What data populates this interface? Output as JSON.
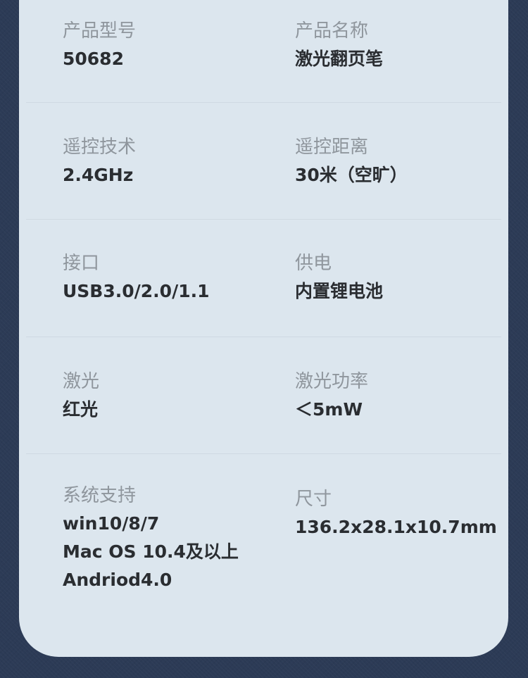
{
  "specs": [
    {
      "label": "产品型号",
      "value": [
        "50682"
      ]
    },
    {
      "label": "产品名称",
      "value": [
        "激光翻页笔"
      ]
    },
    {
      "label": "遥控技术",
      "value": [
        "2.4GHz"
      ]
    },
    {
      "label": "遥控距离",
      "value": [
        "30米（空旷）"
      ]
    },
    {
      "label": "接口",
      "value": [
        "USB3.0/2.0/1.1"
      ]
    },
    {
      "label": "供电",
      "value": [
        "内置锂电池"
      ]
    },
    {
      "label": "激光",
      "value": [
        "红光"
      ]
    },
    {
      "label": "激光功率",
      "value": [
        "＜5mW"
      ]
    },
    {
      "label": "系统支持",
      "value": [
        "win10/8/7",
        "Mac OS 10.4及以上",
        "Andriod4.0"
      ]
    },
    {
      "label": "尺寸",
      "value": [
        "136.2x28.1x10.7mm"
      ]
    }
  ],
  "colors": {
    "background": "#2c3b56",
    "card": "#dce6ee",
    "label": "#8f969d",
    "value": "#2a2d31"
  }
}
